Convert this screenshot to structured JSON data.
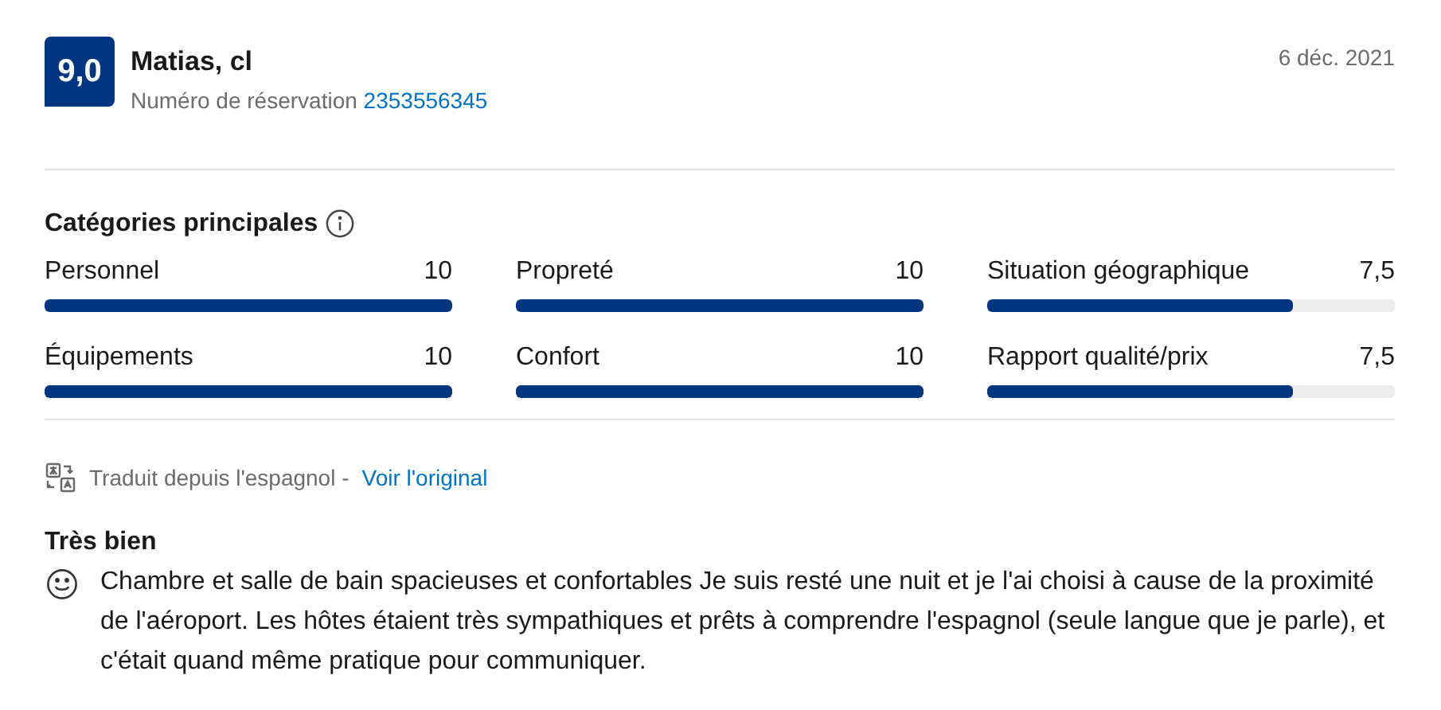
{
  "review": {
    "score": "9,0",
    "name": "Matias, cl",
    "booking_label": "Numéro de réservation",
    "booking_number": "2353556345",
    "date": "6 déc. 2021"
  },
  "categories": {
    "title": "Catégories principales",
    "items": [
      {
        "label": "Personnel",
        "reading": "10",
        "level": 1
      },
      {
        "label": "Propreté",
        "reading": "10",
        "level": 1
      },
      {
        "label": "Situation géographique",
        "reading": "7,5",
        "level": 0.75
      },
      {
        "label": "Équipements",
        "reading": "10",
        "level": 1
      },
      {
        "label": "Confort",
        "reading": "10",
        "level": 1
      },
      {
        "label": "Rapport qualité/prix",
        "reading": "7,5",
        "level": 0.75
      }
    ]
  },
  "translation": {
    "note": "Traduit depuis l'espagnol -",
    "link": "Voir l'original"
  },
  "comment": {
    "title": "Très bien",
    "text": "Chambre et salle de bain spacieuses et confortables Je suis resté une nuit et je l'ai choisi à cause de la proximité de l'aéroport. Les hôtes étaient très sympathiques et prêts à comprendre l'espagnol (seule langue que je parle), et c'était quand même pratique pour communiquer."
  }
}
